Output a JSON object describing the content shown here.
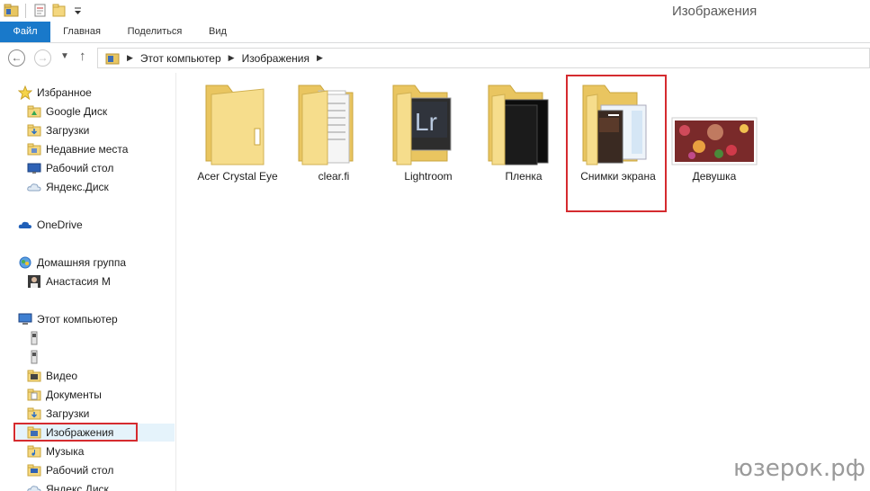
{
  "window": {
    "title": "Изображения"
  },
  "ribbon": {
    "tabs": [
      {
        "label": "Файл"
      },
      {
        "label": "Главная"
      },
      {
        "label": "Поделиться"
      },
      {
        "label": "Вид"
      }
    ]
  },
  "address": {
    "crumbs": [
      {
        "label": "Этот компьютер"
      },
      {
        "label": "Изображения"
      }
    ]
  },
  "sidebar": {
    "favorites": {
      "label": "Избранное",
      "items": [
        {
          "label": "Google Диск"
        },
        {
          "label": "Загрузки"
        },
        {
          "label": "Недавние места"
        },
        {
          "label": "Рабочий стол"
        },
        {
          "label": "Яндекс.Диск"
        }
      ]
    },
    "onedrive": {
      "label": "OneDrive"
    },
    "homegroup": {
      "label": "Домашняя группа",
      "items": [
        {
          "label": "Анастасия М"
        }
      ]
    },
    "computer": {
      "label": "Этот компьютер",
      "items": [
        {
          "label": ""
        },
        {
          "label": ""
        },
        {
          "label": "Видео"
        },
        {
          "label": "Документы"
        },
        {
          "label": "Загрузки"
        },
        {
          "label": "Изображения"
        },
        {
          "label": "Музыка"
        },
        {
          "label": "Рабочий стол"
        },
        {
          "label": "Яндекс.Диск"
        }
      ]
    }
  },
  "files": [
    {
      "name": "Acer Crystal Eye",
      "icon": "folder-icon"
    },
    {
      "name": "clear.fi",
      "icon": "folder-documents-icon"
    },
    {
      "name": "Lightroom",
      "icon": "folder-lightroom-icon"
    },
    {
      "name": "Пленка",
      "icon": "folder-dark-icon"
    },
    {
      "name": "Снимки экрана",
      "icon": "folder-screenshots-icon"
    },
    {
      "name": "Девушка",
      "icon": "image-thumbnail-icon"
    }
  ],
  "watermark": "юзерок.рф",
  "colors": {
    "accent": "#1979ca",
    "highlight": "#d52b2f",
    "folder": "#f4d77f"
  }
}
